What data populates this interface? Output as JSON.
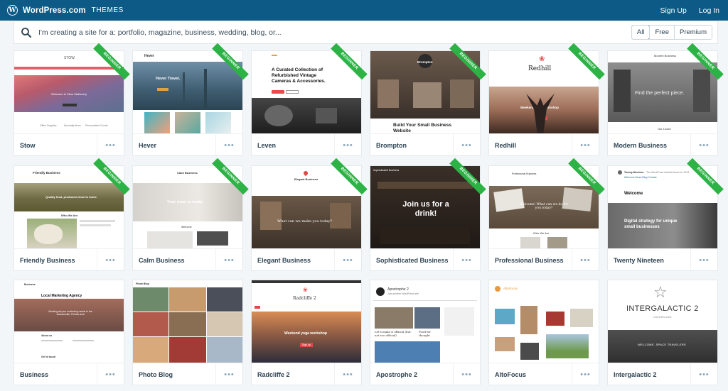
{
  "header": {
    "brand": "WordPress.com",
    "section": "THEMES",
    "signup": "Sign Up",
    "login": "Log In"
  },
  "search": {
    "placeholder": "I'm creating a site for a: portfolio, magazine, business, wedding, blog, or...",
    "filters": [
      "All",
      "Free",
      "Premium"
    ],
    "active_filter": "All"
  },
  "badge_label": "BEGINNER",
  "more_label": "•••",
  "themes": [
    {
      "name": "Stow",
      "beginner": true,
      "thumb": {
        "title": "STOW",
        "hero": "Welcome to Stow Stationery",
        "captions": [
          "Office Supplies",
          "Specialty Items",
          "Personalized Goods"
        ]
      }
    },
    {
      "name": "Hever",
      "beginner": true,
      "thumb": {
        "title": "Hever",
        "hero": "Hever Travel."
      }
    },
    {
      "name": "Leven",
      "beginner": true,
      "thumb": {
        "hero": "A Curated Collection of Refurbished Vintage Cameras & Accessories."
      }
    },
    {
      "name": "Brompton",
      "beginner": true,
      "thumb": {
        "title": "Brompton",
        "hero": "Build Your Small Business Website"
      }
    },
    {
      "name": "Redhill",
      "beginner": true,
      "thumb": {
        "title": "Redhill",
        "hero": "Weekend yoga workshop"
      }
    },
    {
      "name": "Modern Business",
      "beginner": true,
      "thumb": {
        "title": "Modern Business",
        "hero": "Find the perfect piece.",
        "sub": "Our Looks"
      }
    },
    {
      "name": "Friendly Business",
      "beginner": true,
      "thumb": {
        "title": "Friendly Business",
        "hero": "Quality food, produced close to home.",
        "sub": "Who We Are"
      }
    },
    {
      "name": "Calm Business",
      "beginner": true,
      "thumb": {
        "title": "Calm Business",
        "hero": "Your room is ready.",
        "sub": "Welcome"
      }
    },
    {
      "name": "Elegant Business",
      "beginner": true,
      "thumb": {
        "title": "Elegant Business",
        "hero": "What can we make you today?"
      }
    },
    {
      "name": "Sophisticated Business",
      "beginner": true,
      "thumb": {
        "title": "Sophisticated Business",
        "hero": "Join us for a drink!"
      }
    },
    {
      "name": "Professional Business",
      "beginner": true,
      "thumb": {
        "title": "Professional Business",
        "hero": "Welcome! What can we do for you today?",
        "sub": "Who We Are"
      }
    },
    {
      "name": "Twenty Nineteen",
      "beginner": true,
      "thumb": {
        "title": "Twenty Nineteen",
        "tagline": "The WordPress default theme for 2019",
        "nav": "Welcome  About  Blog  Contact",
        "heading": "Welcome",
        "hero": "Digital strategy for unique small businesses"
      }
    },
    {
      "name": "Business",
      "beginner": false,
      "thumb": {
        "title": "Business",
        "heading": "Local Marketing Agency",
        "hero": "Working all your marketing needs in the Jacksonville, Florida area",
        "sub": "About us",
        "sub2": "Get in touch"
      }
    },
    {
      "name": "Photo Blog",
      "beginner": false,
      "thumb": {
        "title": "Photo Blog"
      }
    },
    {
      "name": "Radcliffe 2",
      "beginner": false,
      "thumb": {
        "title": "Radcliffe 2",
        "hero": "Weekend yoga workshop",
        "btn": "Sign up"
      }
    },
    {
      "name": "Apostrophe 2",
      "beginner": false,
      "thumb": {
        "title": "Apostrophe 2",
        "tagline": "Just another WordPress site",
        "caption1": "Let's make it official (but not too official)",
        "caption2": "Food for thought"
      }
    },
    {
      "name": "AltoFocus",
      "beginner": false,
      "thumb": {
        "title": "AltoFocus"
      }
    },
    {
      "name": "Intergalactic 2",
      "beginner": false,
      "thumb": {
        "title": "INTERGALACTIC 2",
        "tagline": "Out of this world",
        "hero": "WELCOME, SPACE TRAVELERS"
      }
    }
  ]
}
